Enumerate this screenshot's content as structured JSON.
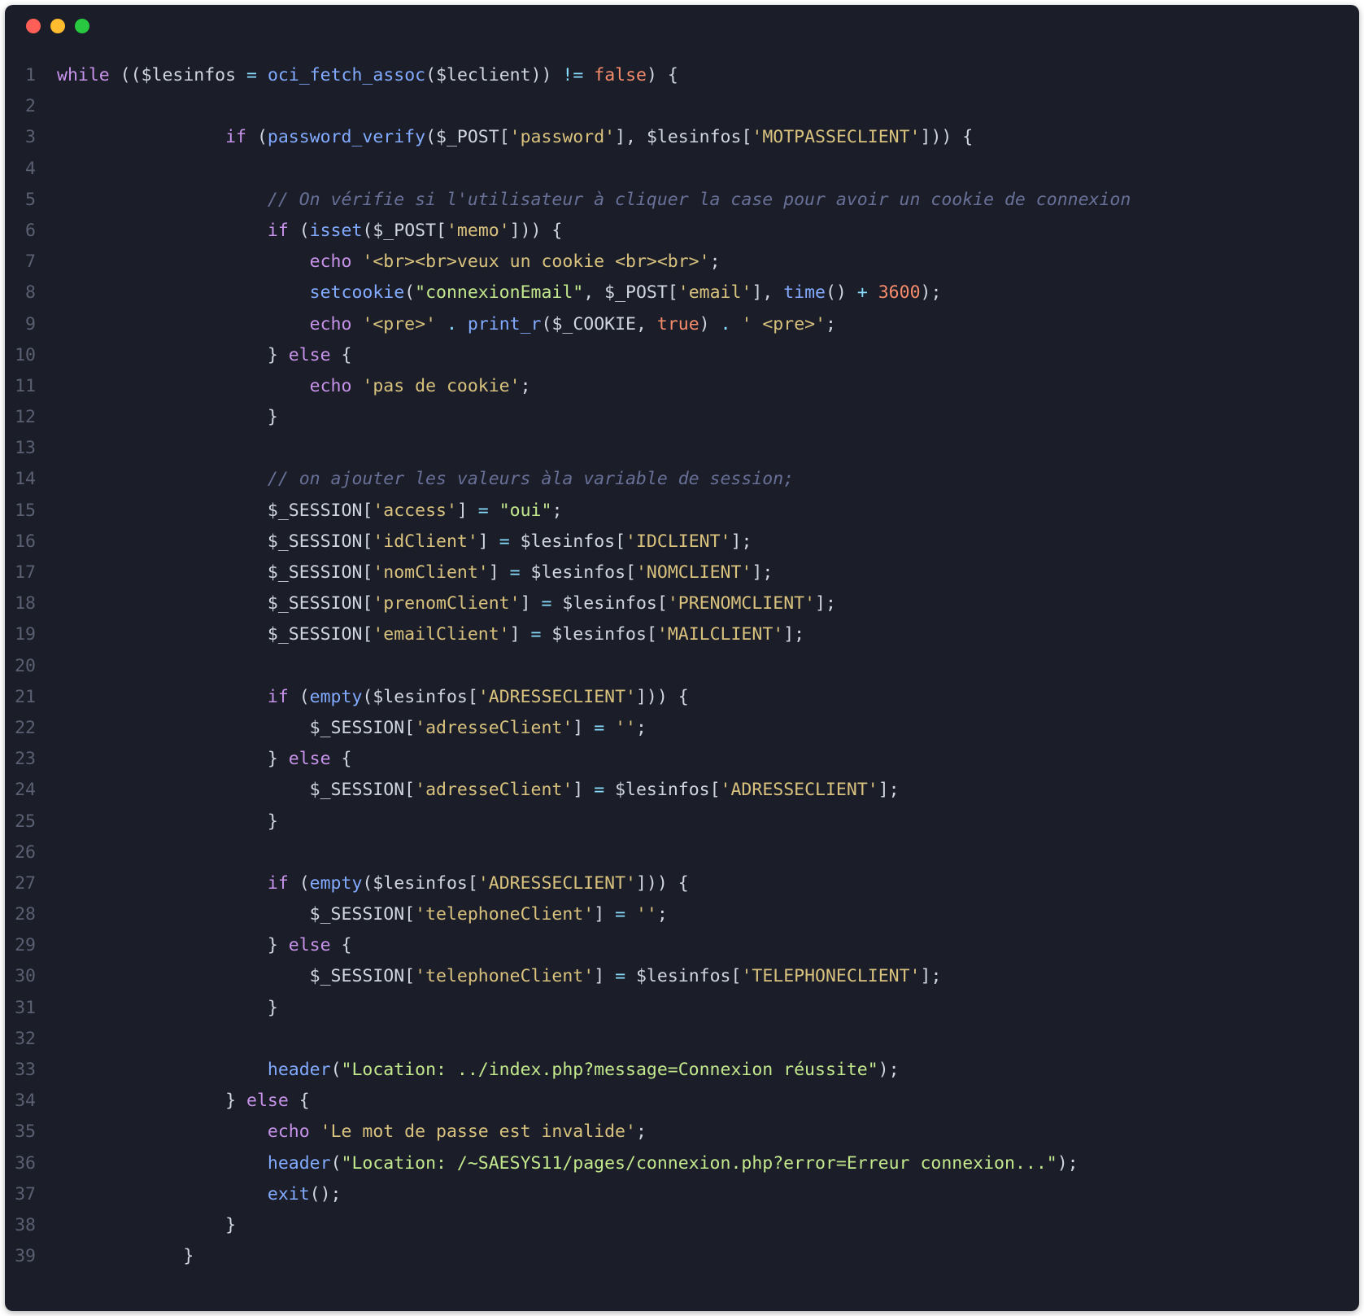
{
  "lineCount": 39,
  "code": {
    "l1": [
      [
        "kw",
        "while"
      ],
      [
        "punc",
        " (("
      ],
      [
        "var",
        "$lesinfos"
      ],
      [
        "punc",
        " "
      ],
      [
        "op",
        "="
      ],
      [
        "punc",
        " "
      ],
      [
        "fn",
        "oci_fetch_assoc"
      ],
      [
        "punc",
        "("
      ],
      [
        "var",
        "$leclient"
      ],
      [
        "punc",
        ")) "
      ],
      [
        "op",
        "!="
      ],
      [
        "punc",
        " "
      ],
      [
        "bool",
        "false"
      ],
      [
        "punc",
        ") {"
      ]
    ],
    "l2": [],
    "l3": [
      [
        "punc",
        "                "
      ],
      [
        "kw",
        "if"
      ],
      [
        "punc",
        " ("
      ],
      [
        "fn",
        "password_verify"
      ],
      [
        "punc",
        "("
      ],
      [
        "var",
        "$_POST"
      ],
      [
        "punc",
        "["
      ],
      [
        "strq",
        "'password'"
      ],
      [
        "punc",
        "], "
      ],
      [
        "var",
        "$lesinfos"
      ],
      [
        "punc",
        "["
      ],
      [
        "strq",
        "'MOTPASSECLIENT'"
      ],
      [
        "punc",
        "])) {"
      ]
    ],
    "l4": [],
    "l5": [
      [
        "punc",
        "                    "
      ],
      [
        "cmt",
        "// On vérifie si l'utilisateur à cliquer la case pour avoir un cookie de connexion"
      ]
    ],
    "l6": [
      [
        "punc",
        "                    "
      ],
      [
        "kw",
        "if"
      ],
      [
        "punc",
        " ("
      ],
      [
        "fn",
        "isset"
      ],
      [
        "punc",
        "("
      ],
      [
        "var",
        "$_POST"
      ],
      [
        "punc",
        "["
      ],
      [
        "strq",
        "'memo'"
      ],
      [
        "punc",
        "])) {"
      ]
    ],
    "l7": [
      [
        "punc",
        "                        "
      ],
      [
        "kw",
        "echo"
      ],
      [
        "punc",
        " "
      ],
      [
        "strq",
        "'<br><br>veux un cookie <br><br>'"
      ],
      [
        "punc",
        ";"
      ]
    ],
    "l8": [
      [
        "punc",
        "                        "
      ],
      [
        "fn",
        "setcookie"
      ],
      [
        "punc",
        "("
      ],
      [
        "str",
        "\"connexionEmail\""
      ],
      [
        "punc",
        ", "
      ],
      [
        "var",
        "$_POST"
      ],
      [
        "punc",
        "["
      ],
      [
        "strq",
        "'email'"
      ],
      [
        "punc",
        "], "
      ],
      [
        "fn",
        "time"
      ],
      [
        "punc",
        "() "
      ],
      [
        "op",
        "+"
      ],
      [
        "punc",
        " "
      ],
      [
        "num",
        "3600"
      ],
      [
        "punc",
        ");"
      ]
    ],
    "l9": [
      [
        "punc",
        "                        "
      ],
      [
        "kw",
        "echo"
      ],
      [
        "punc",
        " "
      ],
      [
        "strq",
        "'<pre>'"
      ],
      [
        "punc",
        " "
      ],
      [
        "op",
        "."
      ],
      [
        "punc",
        " "
      ],
      [
        "fn",
        "print_r"
      ],
      [
        "punc",
        "("
      ],
      [
        "var",
        "$_COOKIE"
      ],
      [
        "punc",
        ", "
      ],
      [
        "bool",
        "true"
      ],
      [
        "punc",
        ") "
      ],
      [
        "op",
        "."
      ],
      [
        "punc",
        " "
      ],
      [
        "strq",
        "' <pre>'"
      ],
      [
        "punc",
        ";"
      ]
    ],
    "l10": [
      [
        "punc",
        "                    } "
      ],
      [
        "kw",
        "else"
      ],
      [
        "punc",
        " {"
      ]
    ],
    "l11": [
      [
        "punc",
        "                        "
      ],
      [
        "kw",
        "echo"
      ],
      [
        "punc",
        " "
      ],
      [
        "strq",
        "'pas de cookie'"
      ],
      [
        "punc",
        ";"
      ]
    ],
    "l12": [
      [
        "punc",
        "                    }"
      ]
    ],
    "l13": [],
    "l14": [
      [
        "punc",
        "                    "
      ],
      [
        "cmt",
        "// on ajouter les valeurs àla variable de session;"
      ]
    ],
    "l15": [
      [
        "punc",
        "                    "
      ],
      [
        "var",
        "$_SESSION"
      ],
      [
        "punc",
        "["
      ],
      [
        "strq",
        "'access'"
      ],
      [
        "punc",
        "] "
      ],
      [
        "op",
        "="
      ],
      [
        "punc",
        " "
      ],
      [
        "str",
        "\"oui\""
      ],
      [
        "punc",
        ";"
      ]
    ],
    "l16": [
      [
        "punc",
        "                    "
      ],
      [
        "var",
        "$_SESSION"
      ],
      [
        "punc",
        "["
      ],
      [
        "strq",
        "'idClient'"
      ],
      [
        "punc",
        "] "
      ],
      [
        "op",
        "="
      ],
      [
        "punc",
        " "
      ],
      [
        "var",
        "$lesinfos"
      ],
      [
        "punc",
        "["
      ],
      [
        "strq",
        "'IDCLIENT'"
      ],
      [
        "punc",
        "];"
      ]
    ],
    "l17": [
      [
        "punc",
        "                    "
      ],
      [
        "var",
        "$_SESSION"
      ],
      [
        "punc",
        "["
      ],
      [
        "strq",
        "'nomClient'"
      ],
      [
        "punc",
        "] "
      ],
      [
        "op",
        "="
      ],
      [
        "punc",
        " "
      ],
      [
        "var",
        "$lesinfos"
      ],
      [
        "punc",
        "["
      ],
      [
        "strq",
        "'NOMCLIENT'"
      ],
      [
        "punc",
        "];"
      ]
    ],
    "l18": [
      [
        "punc",
        "                    "
      ],
      [
        "var",
        "$_SESSION"
      ],
      [
        "punc",
        "["
      ],
      [
        "strq",
        "'prenomClient'"
      ],
      [
        "punc",
        "] "
      ],
      [
        "op",
        "="
      ],
      [
        "punc",
        " "
      ],
      [
        "var",
        "$lesinfos"
      ],
      [
        "punc",
        "["
      ],
      [
        "strq",
        "'PRENOMCLIENT'"
      ],
      [
        "punc",
        "];"
      ]
    ],
    "l19": [
      [
        "punc",
        "                    "
      ],
      [
        "var",
        "$_SESSION"
      ],
      [
        "punc",
        "["
      ],
      [
        "strq",
        "'emailClient'"
      ],
      [
        "punc",
        "] "
      ],
      [
        "op",
        "="
      ],
      [
        "punc",
        " "
      ],
      [
        "var",
        "$lesinfos"
      ],
      [
        "punc",
        "["
      ],
      [
        "strq",
        "'MAILCLIENT'"
      ],
      [
        "punc",
        "];"
      ]
    ],
    "l20": [],
    "l21": [
      [
        "punc",
        "                    "
      ],
      [
        "kw",
        "if"
      ],
      [
        "punc",
        " ("
      ],
      [
        "fn",
        "empty"
      ],
      [
        "punc",
        "("
      ],
      [
        "var",
        "$lesinfos"
      ],
      [
        "punc",
        "["
      ],
      [
        "strq",
        "'ADRESSECLIENT'"
      ],
      [
        "punc",
        "])) {"
      ]
    ],
    "l22": [
      [
        "punc",
        "                        "
      ],
      [
        "var",
        "$_SESSION"
      ],
      [
        "punc",
        "["
      ],
      [
        "strq",
        "'adresseClient'"
      ],
      [
        "punc",
        "] "
      ],
      [
        "op",
        "="
      ],
      [
        "punc",
        " "
      ],
      [
        "strq",
        "''"
      ],
      [
        "punc",
        ";"
      ]
    ],
    "l23": [
      [
        "punc",
        "                    } "
      ],
      [
        "kw",
        "else"
      ],
      [
        "punc",
        " {"
      ]
    ],
    "l24": [
      [
        "punc",
        "                        "
      ],
      [
        "var",
        "$_SESSION"
      ],
      [
        "punc",
        "["
      ],
      [
        "strq",
        "'adresseClient'"
      ],
      [
        "punc",
        "] "
      ],
      [
        "op",
        "="
      ],
      [
        "punc",
        " "
      ],
      [
        "var",
        "$lesinfos"
      ],
      [
        "punc",
        "["
      ],
      [
        "strq",
        "'ADRESSECLIENT'"
      ],
      [
        "punc",
        "];"
      ]
    ],
    "l25": [
      [
        "punc",
        "                    }"
      ]
    ],
    "l26": [],
    "l27": [
      [
        "punc",
        "                    "
      ],
      [
        "kw",
        "if"
      ],
      [
        "punc",
        " ("
      ],
      [
        "fn",
        "empty"
      ],
      [
        "punc",
        "("
      ],
      [
        "var",
        "$lesinfos"
      ],
      [
        "punc",
        "["
      ],
      [
        "strq",
        "'ADRESSECLIENT'"
      ],
      [
        "punc",
        "])) {"
      ]
    ],
    "l28": [
      [
        "punc",
        "                        "
      ],
      [
        "var",
        "$_SESSION"
      ],
      [
        "punc",
        "["
      ],
      [
        "strq",
        "'telephoneClient'"
      ],
      [
        "punc",
        "] "
      ],
      [
        "op",
        "="
      ],
      [
        "punc",
        " "
      ],
      [
        "strq",
        "''"
      ],
      [
        "punc",
        ";"
      ]
    ],
    "l29": [
      [
        "punc",
        "                    } "
      ],
      [
        "kw",
        "else"
      ],
      [
        "punc",
        " {"
      ]
    ],
    "l30": [
      [
        "punc",
        "                        "
      ],
      [
        "var",
        "$_SESSION"
      ],
      [
        "punc",
        "["
      ],
      [
        "strq",
        "'telephoneClient'"
      ],
      [
        "punc",
        "] "
      ],
      [
        "op",
        "="
      ],
      [
        "punc",
        " "
      ],
      [
        "var",
        "$lesinfos"
      ],
      [
        "punc",
        "["
      ],
      [
        "strq",
        "'TELEPHONECLIENT'"
      ],
      [
        "punc",
        "];"
      ]
    ],
    "l31": [
      [
        "punc",
        "                    }"
      ]
    ],
    "l32": [],
    "l33": [
      [
        "punc",
        "                    "
      ],
      [
        "fn",
        "header"
      ],
      [
        "punc",
        "("
      ],
      [
        "str",
        "\"Location: ../index.php?message=Connexion réussite\""
      ],
      [
        "punc",
        ");"
      ]
    ],
    "l34": [
      [
        "punc",
        "                } "
      ],
      [
        "kw",
        "else"
      ],
      [
        "punc",
        " {"
      ]
    ],
    "l35": [
      [
        "punc",
        "                    "
      ],
      [
        "kw",
        "echo"
      ],
      [
        "punc",
        " "
      ],
      [
        "strq",
        "'Le mot de passe est invalide'"
      ],
      [
        "punc",
        ";"
      ]
    ],
    "l36": [
      [
        "punc",
        "                    "
      ],
      [
        "fn",
        "header"
      ],
      [
        "punc",
        "("
      ],
      [
        "str",
        "\"Location: /~SAESYS11/pages/connexion.php?error=Erreur connexion...\""
      ],
      [
        "punc",
        ");"
      ]
    ],
    "l37": [
      [
        "punc",
        "                    "
      ],
      [
        "fn",
        "exit"
      ],
      [
        "punc",
        "();"
      ]
    ],
    "l38": [
      [
        "punc",
        "                }"
      ]
    ],
    "l39": [
      [
        "punc",
        "            }"
      ]
    ]
  }
}
